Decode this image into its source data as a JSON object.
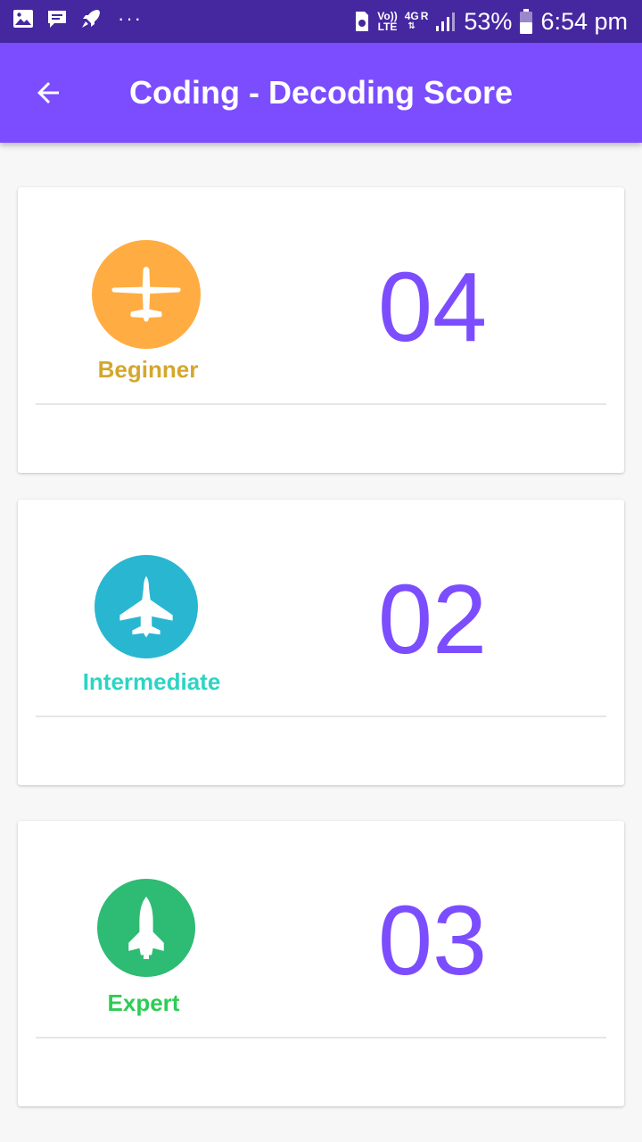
{
  "status_bar": {
    "network_small_1": "Vo))",
    "network_small_2": "LTE",
    "network_4g": "4G",
    "roaming": "R",
    "battery": "53%",
    "time": "6:54 pm",
    "dots": "···"
  },
  "app_bar": {
    "title": "Coding - Decoding Score",
    "back_icon": "arrow-back-icon"
  },
  "levels": [
    {
      "label": "Beginner",
      "score": "04",
      "icon": "small-plane-icon",
      "icon_color": "#ffad42",
      "label_color": "#d4a72c"
    },
    {
      "label": "Intermediate",
      "score": "02",
      "icon": "fighter-jet-icon",
      "icon_color": "#29b6d1",
      "label_color": "#2dd4c4"
    },
    {
      "label": "Expert",
      "score": "03",
      "icon": "space-shuttle-icon",
      "icon_color": "#2ebb73",
      "label_color": "#2ecc55"
    }
  ],
  "colors": {
    "status_bar": "#4527a0",
    "app_bar": "#7c4dff",
    "score_text": "#7c4dff",
    "background": "#f7f7f7"
  }
}
